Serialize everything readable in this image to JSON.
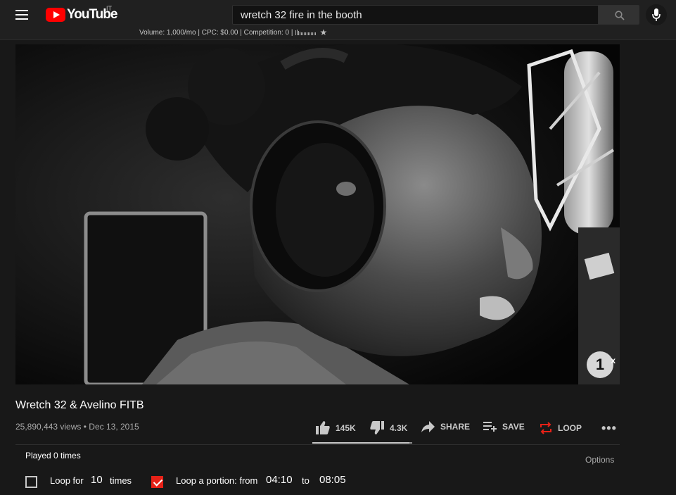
{
  "header": {
    "logo_text": "YouTube",
    "country_code": "IT",
    "search_value": "wretch 32 fire in the booth",
    "keyword_stats": "Volume: 1,000/mo | CPC: $0.00 | Competition: 0 |",
    "keyword_trend": [
      0.9,
      1.0,
      0.7,
      0.6,
      0.55,
      0.5,
      0.5,
      0.55,
      0.5,
      0.5,
      0.5,
      0.5,
      0.5,
      0.5,
      0.5
    ]
  },
  "video": {
    "watermark": "1",
    "watermark_sup": "x",
    "title": "Wretch 32 & Avelino FITB",
    "views": "25,890,443 views",
    "date": "Dec 13, 2015"
  },
  "actions": {
    "likes": "145K",
    "dislikes": "4.3K",
    "share": "SHARE",
    "save": "SAVE",
    "loop": "LOOP",
    "like_ratio": 0.971
  },
  "loop_panel": {
    "played": "Played 0 times",
    "options": "Options",
    "loop_for_label": "Loop for",
    "loop_count": "10",
    "times_label": "times",
    "loop_for_checked": false,
    "portion_label": "Loop a portion: from",
    "portion_checked": true,
    "from": "04:10",
    "to_label": "to",
    "to": "08:05"
  },
  "colors": {
    "brand_red": "#ff0000",
    "loop_red": "#e62117",
    "background": "#181818"
  }
}
